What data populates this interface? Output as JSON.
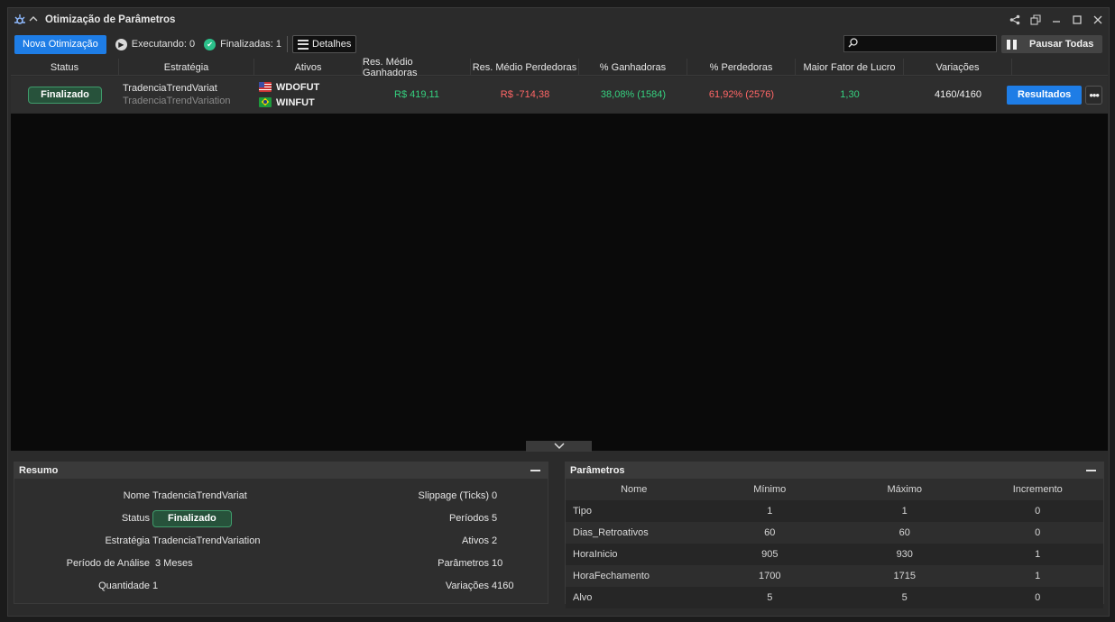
{
  "window": {
    "title": "Otimização de Parâmetros"
  },
  "toolbar": {
    "new_button": "Nova Otimização",
    "running_label": "Executando:",
    "running_count": "0",
    "finished_label": "Finalizadas:",
    "finished_count": "1",
    "details_button": "Detalhes",
    "search_value": "",
    "pause_button": "Pausar Todas"
  },
  "table": {
    "columns": [
      "Status",
      "Estratégia",
      "Ativos",
      "Res. Médio Ganhadoras",
      "Res. Médio Perdedoras",
      "% Ganhadoras",
      "% Perdedoras",
      "Maior Fator de Lucro",
      "Variações",
      ""
    ],
    "rows": [
      {
        "status": "Finalizado",
        "strategy_short": "TradenciaTrendVariat",
        "strategy_full": "TradenciaTrendVariation",
        "assets": [
          {
            "flag": "us",
            "symbol": "WDOFUT"
          },
          {
            "flag": "br",
            "symbol": "WINFUT"
          }
        ],
        "avg_win": "R$ 419,11",
        "avg_loss": "R$ -714,38",
        "pct_win": "38,08% (1584)",
        "pct_loss": "61,92% (2576)",
        "max_profit_factor": "1,30",
        "variations": "4160/4160",
        "results_button": "Resultados",
        "more_button": "•••"
      }
    ]
  },
  "summary": {
    "title": "Resumo",
    "name_label": "Nome",
    "name_value": "TradenciaTrendVariat",
    "status_label": "Status",
    "status_value": "Finalizado",
    "strategy_label": "Estratégia",
    "strategy_value": "TradenciaTrendVariation",
    "period_label": "Período de Análise",
    "period_value": "3 Meses",
    "quantity_label": "Quantidade",
    "quantity_value": "1",
    "slippage_label": "Slippage (Ticks)",
    "slippage_value": "0",
    "periods_label": "Períodos",
    "periods_value": "5",
    "assets_label": "Ativos",
    "assets_value": "2",
    "params_label": "Parâmetros",
    "params_value": "10",
    "variations_label": "Variações",
    "variations_value": "4160"
  },
  "parameters": {
    "title": "Parâmetros",
    "columns": [
      "Nome",
      "Mínimo",
      "Máximo",
      "Incremento"
    ],
    "rows": [
      [
        "Tipo",
        "1",
        "1",
        "0"
      ],
      [
        "Dias_Retroativos",
        "60",
        "60",
        "0"
      ],
      [
        "HoraInicio",
        "905",
        "930",
        "1"
      ],
      [
        "HoraFechamento",
        "1700",
        "1715",
        "1"
      ],
      [
        "Alvo",
        "5",
        "5",
        "0"
      ]
    ]
  },
  "colors": {
    "accent": "#1e7de6",
    "positive": "#35d07f",
    "negative": "#ff6666",
    "badge_bg": "#27523b"
  }
}
